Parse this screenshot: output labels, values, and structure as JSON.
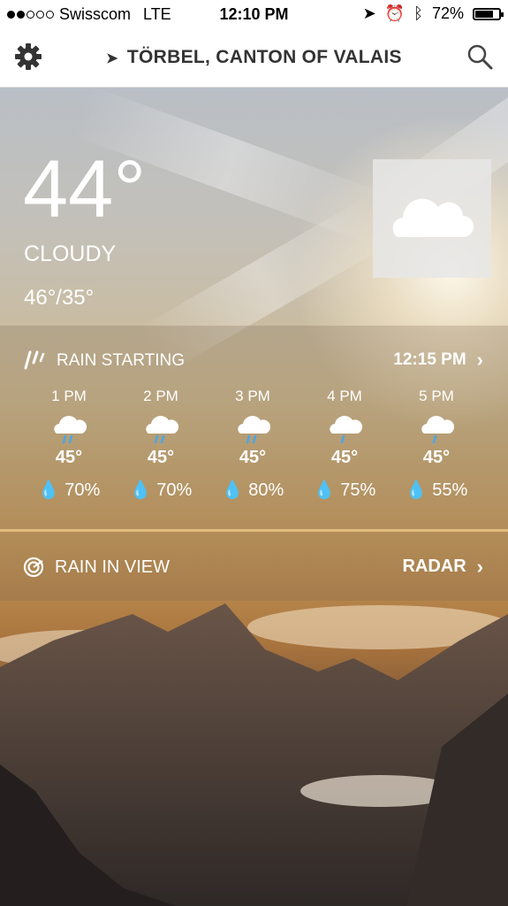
{
  "status": {
    "carrier": "Swisscom",
    "network": "LTE",
    "time": "12:10 PM",
    "battery": "72%"
  },
  "nav": {
    "location": "TÖRBEL, CANTON OF VALAIS"
  },
  "current": {
    "temp": "44°",
    "condition": "CLOUDY",
    "hilo": "46°/35°",
    "icon": "cloud-icon"
  },
  "rain": {
    "title": "RAIN STARTING",
    "start_time": "12:15 PM",
    "hours": [
      {
        "time": "1 PM",
        "temp": "45°",
        "precip": "70%"
      },
      {
        "time": "2 PM",
        "temp": "45°",
        "precip": "70%"
      },
      {
        "time": "3 PM",
        "temp": "45°",
        "precip": "80%"
      },
      {
        "time": "4 PM",
        "temp": "45°",
        "precip": "75%"
      },
      {
        "time": "5 PM",
        "temp": "45°",
        "precip": "55%"
      }
    ]
  },
  "radar": {
    "label": "RAIN IN VIEW",
    "link": "RADAR"
  },
  "colors": {
    "rain_blue": "#4aa6e8"
  }
}
